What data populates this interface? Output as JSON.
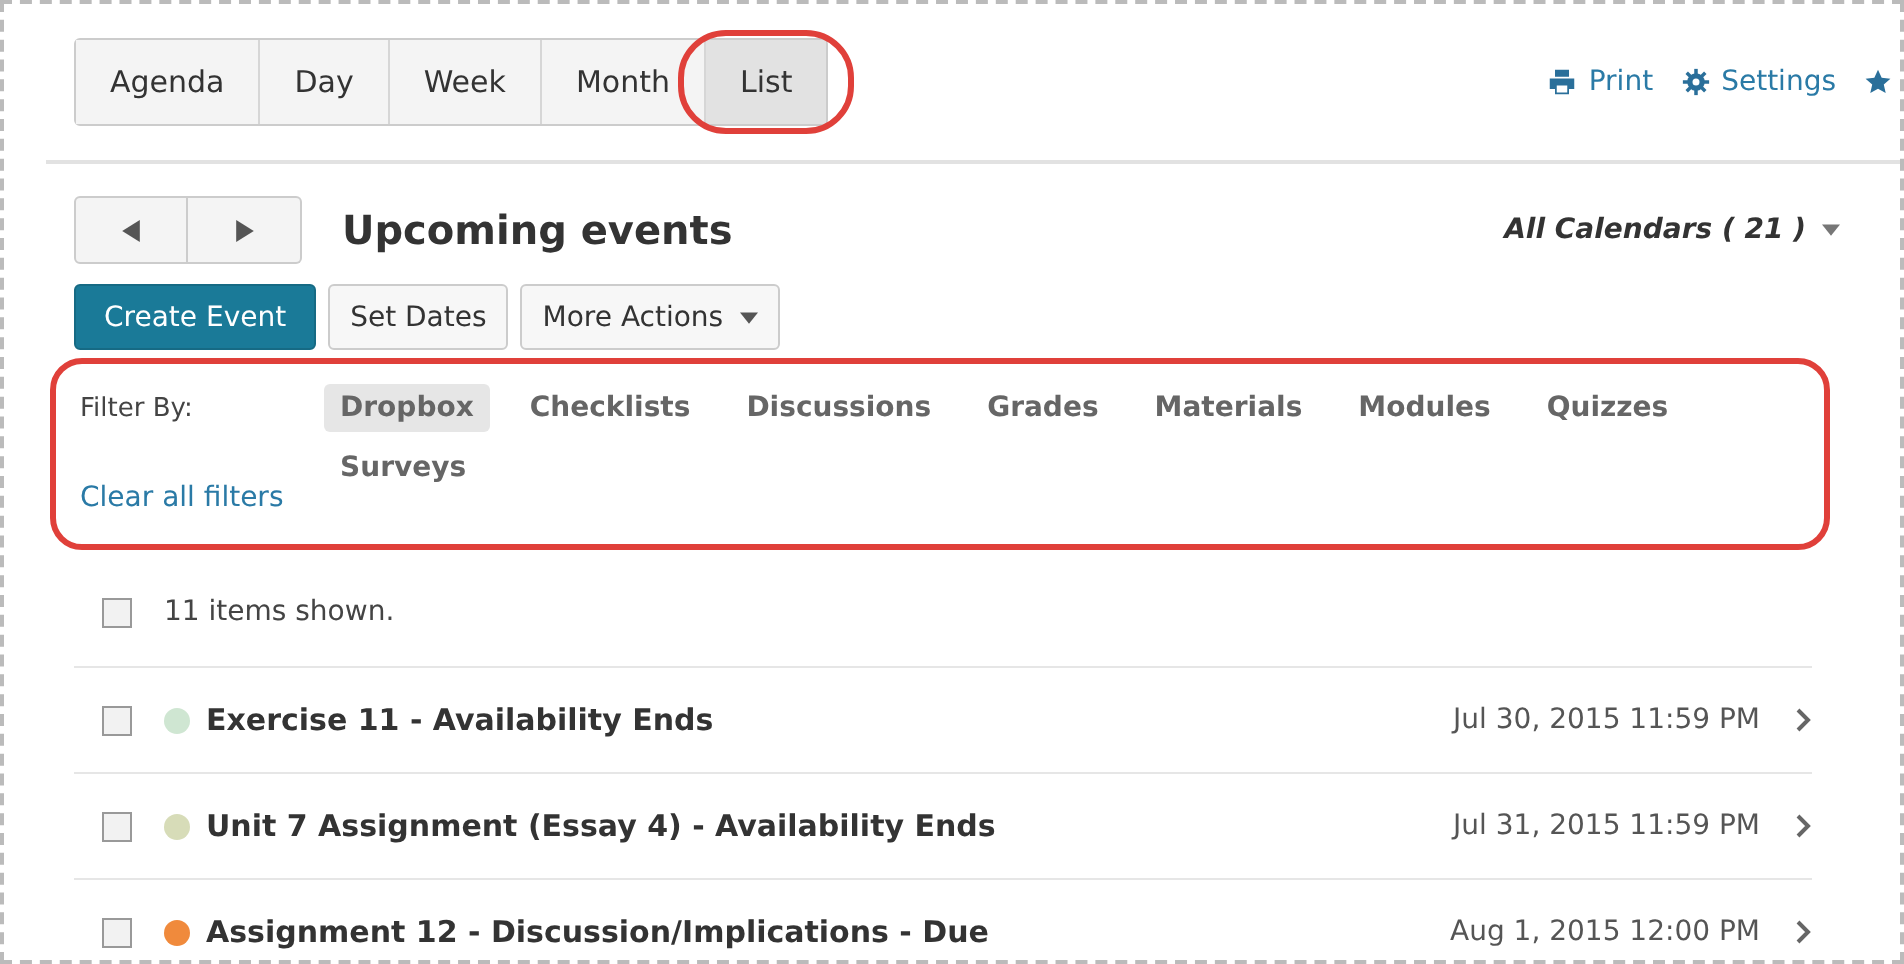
{
  "view_tabs": [
    {
      "label": "Agenda",
      "selected": false
    },
    {
      "label": "Day",
      "selected": false
    },
    {
      "label": "Week",
      "selected": false
    },
    {
      "label": "Month",
      "selected": false
    },
    {
      "label": "List",
      "selected": true
    }
  ],
  "top_links": [
    {
      "kind": "print",
      "label": "Print"
    },
    {
      "kind": "settings",
      "label": "Settings"
    },
    {
      "kind": "star"
    }
  ],
  "heading": "Upcoming events",
  "calendar_selector": "All Calendars ( 21 )",
  "buttons": [
    {
      "kind": "primary",
      "label": "Create Event"
    },
    {
      "kind": "plain",
      "label": "Set Dates"
    },
    {
      "kind": "menu",
      "label": "More Actions"
    }
  ],
  "filter": {
    "label": "Filter By:",
    "clear_link": "Clear all filters",
    "options": [
      {
        "label": "Dropbox",
        "selected": true
      },
      {
        "label": "Checklists",
        "selected": false
      },
      {
        "label": "Discussions",
        "selected": false
      },
      {
        "label": "Grades",
        "selected": false
      },
      {
        "label": "Materials",
        "selected": false
      },
      {
        "label": "Modules",
        "selected": false
      },
      {
        "label": "Quizzes",
        "selected": false
      },
      {
        "label": "Surveys",
        "selected": false
      }
    ]
  },
  "summary": {
    "text": "11 items shown.",
    "checked": false
  },
  "events": [
    {
      "title": "Exercise 11 - Availability Ends",
      "date": "Jul 30, 2015 11:59 PM",
      "color": "#cfe6d2",
      "checked": false
    },
    {
      "title": "Unit 7 Assignment (Essay 4) - Availability Ends",
      "date": "Jul 31, 2015 11:59 PM",
      "color": "#d7dcb8",
      "checked": false
    },
    {
      "title": "Assignment 12 - Discussion/Implications - Due",
      "date": "Aug 1, 2015 12:00 PM",
      "color": "#f08a3c",
      "checked": false
    }
  ]
}
